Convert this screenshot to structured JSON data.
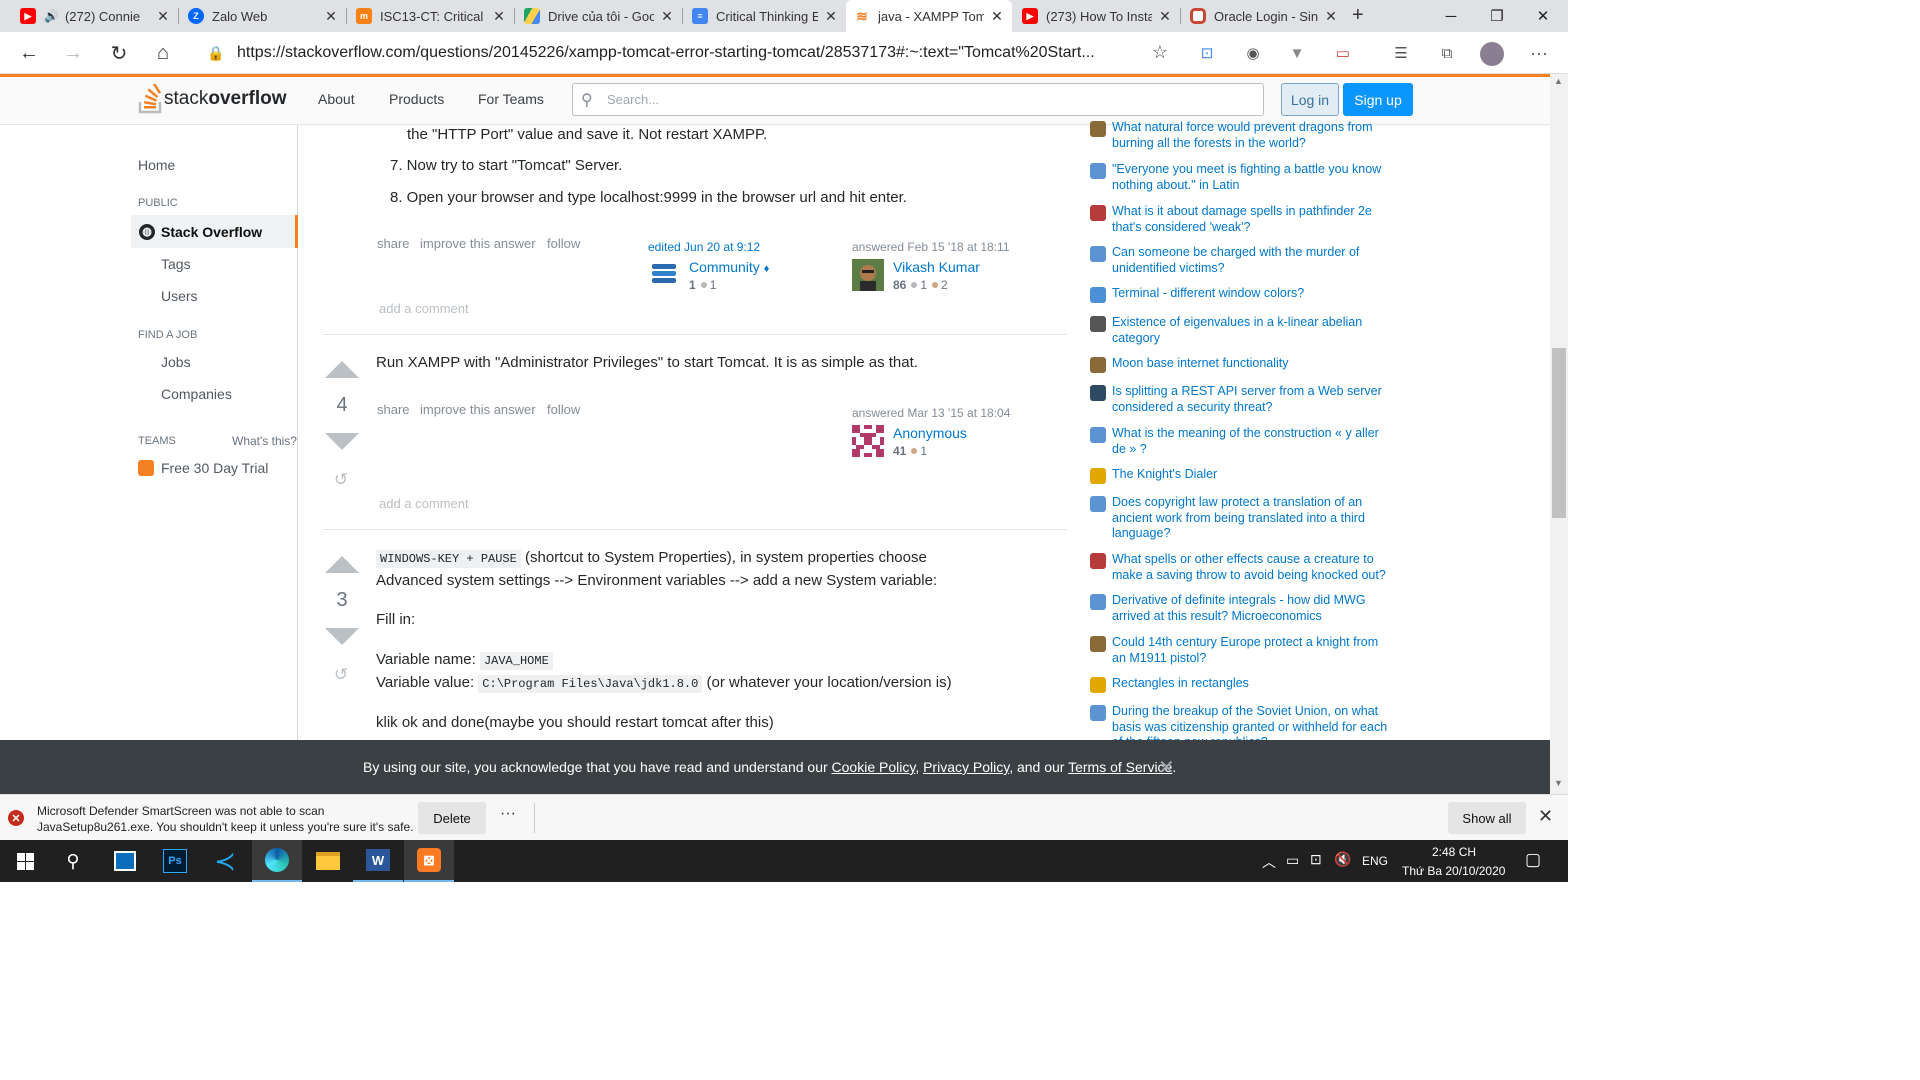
{
  "browser": {
    "tabs": [
      {
        "title": "(272) Connie",
        "icon": "youtube-icon",
        "color": "#ff0000",
        "audio": true
      },
      {
        "title": "Zalo Web",
        "icon": "zalo-icon",
        "color": "#0068ff"
      },
      {
        "title": "ISC13-CT: Critical T",
        "icon": "moodle-icon",
        "color": "#f98012"
      },
      {
        "title": "Drive của tôi - Goo",
        "icon": "google-drive-icon",
        "color": "#1fa463"
      },
      {
        "title": "Critical Thinking Ex",
        "icon": "google-docs-icon",
        "color": "#4285f4"
      },
      {
        "title": "java - XAMPP Tom",
        "icon": "stackoverflow-icon",
        "color": "#f48024",
        "active": true
      },
      {
        "title": "(273) How To Insta",
        "icon": "youtube-icon",
        "color": "#ff0000"
      },
      {
        "title": "Oracle Login - Sin",
        "icon": "oracle-icon",
        "color": "#c74634"
      }
    ],
    "new_tab": "+",
    "url": "https://stackoverflow.com/questions/20145226/xampp-tomcat-error-starting-tomcat/28537173#:~:text=\"Tomcat%20Start..."
  },
  "so_header": {
    "logo_stack": "stack",
    "logo_overflow": "overflow",
    "nav": [
      "About",
      "Products",
      "For Teams"
    ],
    "search_placeholder": "Search...",
    "login": "Log in",
    "signup": "Sign up"
  },
  "left_nav": {
    "home": "Home",
    "public": "PUBLIC",
    "stack_overflow": "Stack Overflow",
    "tags": "Tags",
    "users": "Users",
    "find_a_job": "FIND A JOB",
    "jobs": "Jobs",
    "companies": "Companies",
    "teams": "TEAMS",
    "whats_this": "What's this?",
    "free_trial": "Free 30 Day Trial"
  },
  "answer1": {
    "step6_tail": "the \"HTTP Port\" value and save it. Not restart XAMPP.",
    "step7": "7. Now try to start \"Tomcat\" Server.",
    "step8": "8. Open your browser and type localhost:9999 in the browser url and hit enter.",
    "actions": [
      "share",
      "improve this answer",
      "follow"
    ],
    "edited": "edited Jun 20 at 9:12",
    "editor": "Community",
    "editor_diamond": "♦",
    "editor_rep": "1",
    "editor_silver": "1",
    "answered": "answered Feb 15 '18 at 18:11",
    "author": "Vikash Kumar",
    "author_rep": "86",
    "author_silver": "1",
    "author_bronze": "2",
    "add_comment": "add a comment"
  },
  "answer2": {
    "votes": "4",
    "body": "Run XAMPP with \"Administrator Privileges\" to start Tomcat. It is as simple as that.",
    "actions": [
      "share",
      "improve this answer",
      "follow"
    ],
    "answered": "answered Mar 13 '15 at 18:04",
    "author": "Anonymous",
    "author_rep": "41",
    "author_bronze": "1",
    "add_comment": "add a comment"
  },
  "answer3": {
    "votes": "3",
    "code1": "WINDOWS-KEY + PAUSE",
    "line1_rest": "(shortcut to System Properties), in system properties choose",
    "line2": "Advanced system settings --> Environment variables --> add a new System variable:",
    "fill_in": "Fill in:",
    "var_name_label": "Variable name:",
    "var_name_value": "JAVA_HOME",
    "var_value_label": "Variable value:",
    "var_value_value": "C:\\Program Files\\Java\\jdk1.8.0",
    "var_value_rest": "(or whatever your location/version is)",
    "last_line": "klik ok and done(maybe you should restart tomcat after this)"
  },
  "hot_questions": [
    {
      "text": "What natural force would prevent dragons from burning all the forests in the world?",
      "icon": "worldbuilding-icon",
      "color": "#8b6a3a"
    },
    {
      "text": "\"Everyone you meet is fighting a battle you know nothing about.\" in Latin",
      "icon": "latin-icon",
      "color": "#5b93d3"
    },
    {
      "text": "What is it about damage spells in pathfinder 2e that's considered 'weak'?",
      "icon": "rpg-icon",
      "color": "#b83b3b"
    },
    {
      "text": "Can someone be charged with the murder of unidentified victims?",
      "icon": "law-icon",
      "color": "#5b93d3"
    },
    {
      "text": "Terminal - different window colors?",
      "icon": "apple-icon",
      "color": "#4b8fd6"
    },
    {
      "text": "Existence of eigenvalues in a k-linear abelian category",
      "icon": "mathoverflow-icon",
      "color": "#555555"
    },
    {
      "text": "Moon base internet functionality",
      "icon": "worldbuilding-icon",
      "color": "#8b6a3a"
    },
    {
      "text": "Is splitting a REST API server from a Web server considered a security threat?",
      "icon": "security-icon",
      "color": "#2e4a62"
    },
    {
      "text": "What is the meaning of the construction « y aller de » ?",
      "icon": "french-icon",
      "color": "#5b93d3"
    },
    {
      "text": "The Knight's Dialer",
      "icon": "codegolf-icon",
      "color": "#e0a800"
    },
    {
      "text": "Does copyright law protect a translation of an ancient work from being translated into a third language?",
      "icon": "law-icon",
      "color": "#5b93d3"
    },
    {
      "text": "What spells or other effects cause a creature to make a saving throw to avoid being knocked out?",
      "icon": "rpg-icon",
      "color": "#b83b3b"
    },
    {
      "text": "Derivative of definite integrals - how did MWG arrived at this result? Microeconomics",
      "icon": "economics-icon",
      "color": "#5b93d3"
    },
    {
      "text": "Could 14th century Europe protect a knight from an M1911 pistol?",
      "icon": "worldbuilding-icon",
      "color": "#8b6a3a"
    },
    {
      "text": "Rectangles in rectangles",
      "icon": "codegolf-icon",
      "color": "#e0a800"
    },
    {
      "text": "During the breakup of the Soviet Union, on what basis was citizenship granted or withheld for each of the fifteen new republics?",
      "icon": "history-icon",
      "color": "#5b93d3"
    }
  ],
  "cookie": {
    "prefix": "By using our site, you acknowledge that you have read and understand our",
    "cookie_policy": "Cookie Policy",
    "sep1": ",",
    "privacy": "Privacy Policy",
    "sep2": ", and our",
    "tos": "Terms of Service",
    "end": "."
  },
  "download_bar": {
    "line1": "Microsoft Defender SmartScreen was not able to scan",
    "line2": "JavaSetup8u261.exe. You shouldn't keep it unless you're sure it's safe.",
    "delete": "Delete",
    "more": "···",
    "show_all": "Show all"
  },
  "taskbar": {
    "lang": "ENG",
    "time": "2:48 CH",
    "date": "Thứ Ba 20/10/2020"
  }
}
